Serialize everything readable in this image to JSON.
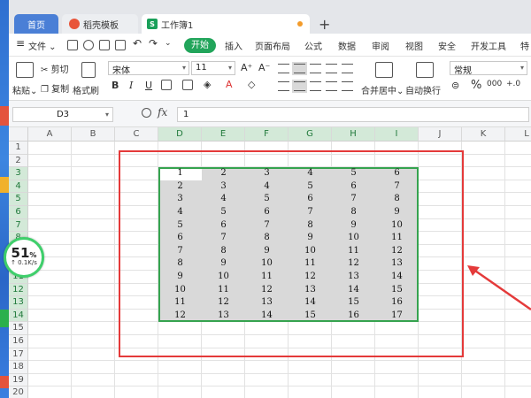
{
  "tabs": {
    "home": "首页",
    "template": "稻壳模板",
    "workbook": "工作簿1",
    "workbook_icon": "S"
  },
  "menu": {
    "file": "文件",
    "items": [
      "开始",
      "插入",
      "页面布局",
      "公式",
      "数据",
      "审阅",
      "视图",
      "安全",
      "开发工具",
      "特"
    ]
  },
  "ribbon": {
    "paste": "粘贴",
    "cut": "剪切",
    "copy": "复制",
    "format_painter": "格式刷",
    "font_name": "宋体",
    "font_size": "11",
    "merge_center": "合并居中",
    "wrap_text": "自动换行",
    "number_format": "常规",
    "bold": "B",
    "italic": "I",
    "underline": "U",
    "font_color_letter": "A",
    "percent": "%"
  },
  "formula_bar": {
    "name_box": "D3",
    "fx": "fx",
    "value": "1"
  },
  "sheet": {
    "columns": [
      "A",
      "B",
      "C",
      "D",
      "E",
      "F",
      "G",
      "H",
      "I",
      "J",
      "K",
      "L"
    ],
    "selected_columns": [
      "D",
      "E",
      "F",
      "G",
      "H",
      "I"
    ],
    "rows": [
      "1",
      "2",
      "3",
      "4",
      "5",
      "6",
      "7",
      "8",
      "9",
      "10",
      "11",
      "12",
      "13",
      "14",
      "15",
      "16",
      "17",
      "18",
      "19",
      "20"
    ],
    "selected_rows": [
      "3",
      "4",
      "5",
      "6",
      "7",
      "8",
      "9",
      "10",
      "11",
      "12",
      "13",
      "14"
    ],
    "data": [
      [
        "1",
        "2",
        "3",
        "4",
        "5",
        "6"
      ],
      [
        "2",
        "3",
        "4",
        "5",
        "6",
        "7"
      ],
      [
        "3",
        "4",
        "5",
        "6",
        "7",
        "8"
      ],
      [
        "4",
        "5",
        "6",
        "7",
        "8",
        "9"
      ],
      [
        "5",
        "6",
        "7",
        "8",
        "9",
        "10"
      ],
      [
        "6",
        "7",
        "8",
        "9",
        "10",
        "11"
      ],
      [
        "7",
        "8",
        "9",
        "10",
        "11",
        "12"
      ],
      [
        "8",
        "9",
        "10",
        "11",
        "12",
        "13"
      ],
      [
        "9",
        "10",
        "11",
        "12",
        "13",
        "14"
      ],
      [
        "10",
        "11",
        "12",
        "13",
        "14",
        "15"
      ],
      [
        "11",
        "12",
        "13",
        "14",
        "15",
        "16"
      ],
      [
        "12",
        "13",
        "14",
        "15",
        "16",
        "17"
      ]
    ]
  },
  "speed_widget": {
    "percent": "51",
    "percent_unit": "%",
    "rate": "↑ 0.1K/s"
  },
  "colors": {
    "accent_green": "#22a55b",
    "selection_border": "#35a34f",
    "annotation_red": "#e43a3a"
  }
}
